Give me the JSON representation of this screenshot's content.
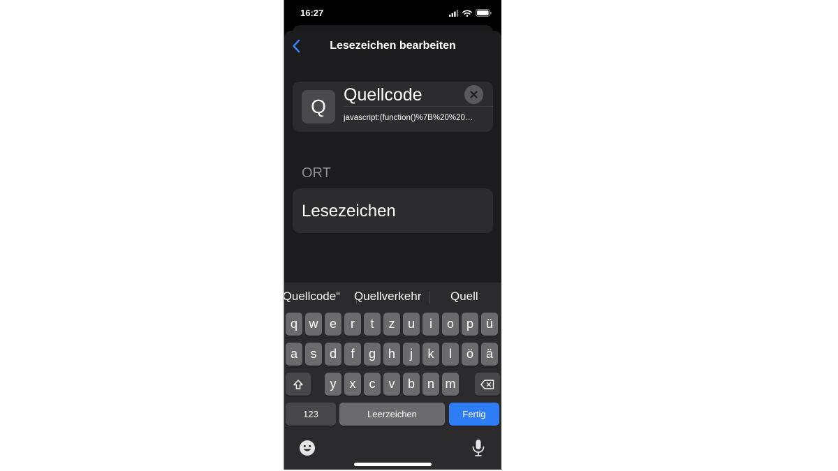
{
  "status_bar": {
    "time": "16:27"
  },
  "nav": {
    "title": "Lesezeichen bearbeiten"
  },
  "bookmark": {
    "thumbnail_letter": "Q",
    "name": "Quellcode",
    "url": "javascript:(function()%7B%20%20…"
  },
  "location": {
    "section_label": "ORT",
    "folder": "Lesezeichen"
  },
  "keyboard": {
    "suggestions": [
      "„Quellcode“",
      "Quellverkehr",
      "Quell"
    ],
    "row1": [
      "q",
      "w",
      "e",
      "r",
      "t",
      "z",
      "u",
      "i",
      "o",
      "p",
      "ü"
    ],
    "row2": [
      "a",
      "s",
      "d",
      "f",
      "g",
      "h",
      "j",
      "k",
      "l",
      "ö",
      "ä"
    ],
    "row3": [
      "y",
      "x",
      "c",
      "v",
      "b",
      "n",
      "m"
    ],
    "numbers_key": "123",
    "space_key": "Leerzeichen",
    "done_key": "Fertig"
  },
  "colors": {
    "accent": "#2f7df6",
    "sheet_background": "#1c1c1e",
    "cell_background": "#2c2c2e",
    "key_background": "#6b6b6e"
  },
  "icons": [
    "back-chevron-icon",
    "clear-icon",
    "signal-icon",
    "wifi-icon",
    "battery-icon",
    "shift-icon",
    "backspace-icon",
    "emoji-icon",
    "microphone-icon"
  ]
}
